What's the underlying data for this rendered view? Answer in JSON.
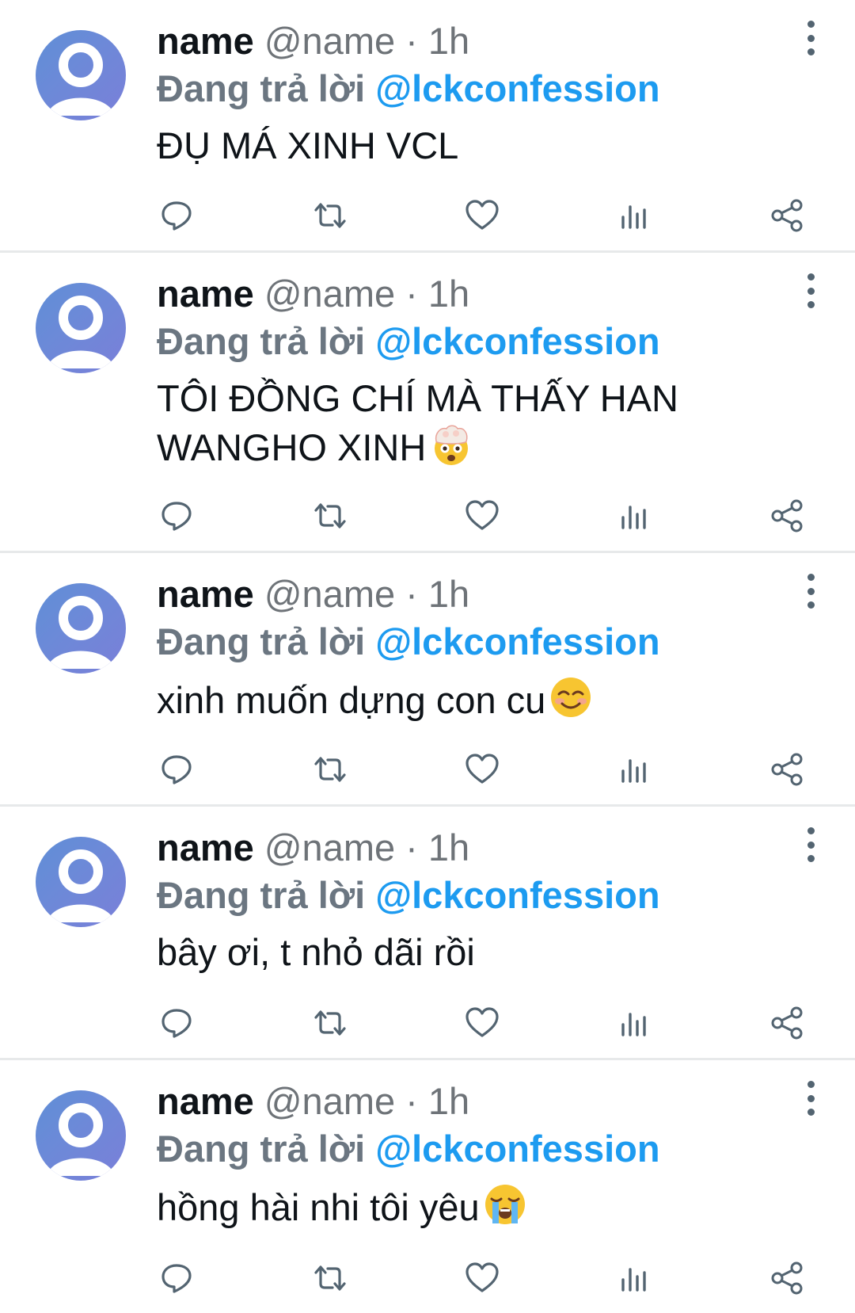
{
  "colors": {
    "text": "#0f1419",
    "meta": "#6e7378",
    "reply_label": "#6b7681",
    "handle_blue": "#1d9bf0",
    "icon": "#536471",
    "divider": "#e7e9ea",
    "avatar": "#6d89d8"
  },
  "icons": {
    "reply": "speech-bubble-icon",
    "retweet": "retweet-icon",
    "like": "heart-icon",
    "views": "bar-chart-icon",
    "share": "share-icon",
    "more": "vertical-ellipsis-icon"
  },
  "tweets": [
    {
      "name": "name",
      "meta": "@name · 1h",
      "reply_label": "Đang trả lời",
      "reply_handle": "@lckconfession",
      "text_lines": [
        "ĐỤ MÁ XINH VCL"
      ],
      "emoji": ""
    },
    {
      "name": "name",
      "meta": "@name · 1h",
      "reply_label": "Đang trả lời",
      "reply_handle": "@lckconfession",
      "text_lines": [
        "TÔI ĐỒNG CHÍ MÀ THẤY HAN",
        "WANGHO XINH"
      ],
      "emoji": "exploding-head-emoji"
    },
    {
      "name": "name",
      "meta": "@name · 1h",
      "reply_label": "Đang trả lời",
      "reply_handle": "@lckconfession",
      "text_lines": [
        "xinh muốn dựng con cu"
      ],
      "emoji": "smiling-face-emoji"
    },
    {
      "name": "name",
      "meta": "@name · 1h",
      "reply_label": "Đang trả lời",
      "reply_handle": "@lckconfession",
      "text_lines": [
        "bây ơi, t nhỏ dãi rồi"
      ],
      "emoji": ""
    },
    {
      "name": "name",
      "meta": "@name · 1h",
      "reply_label": "Đang trả lời",
      "reply_handle": "@lckconfession",
      "text_lines": [
        "hồng hài nhi tôi yêu"
      ],
      "emoji": "loudly-crying-face-emoji"
    }
  ]
}
